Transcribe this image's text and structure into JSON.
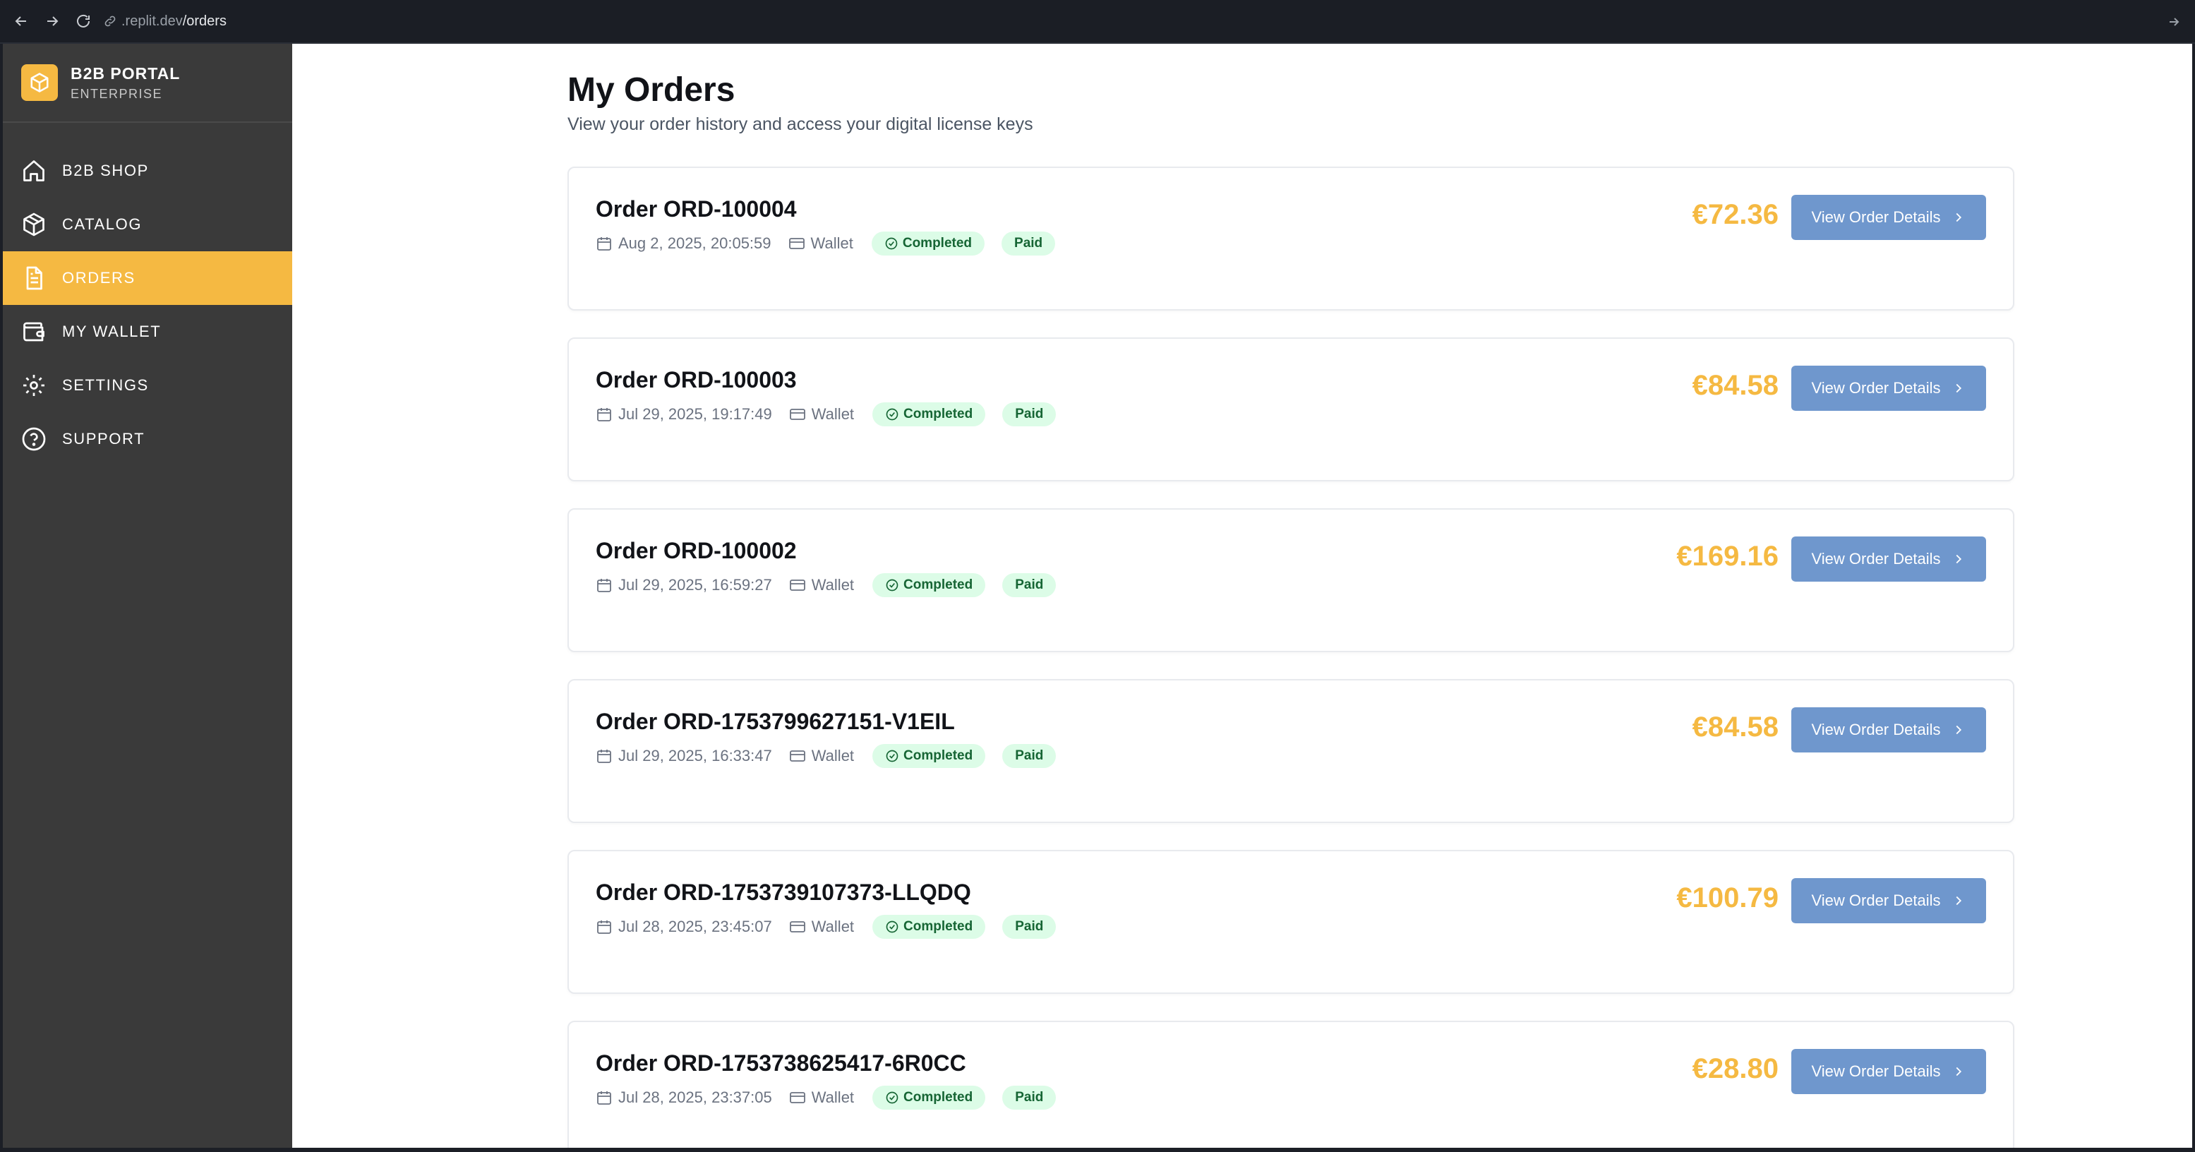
{
  "browser": {
    "url_domain": ".replit.dev",
    "url_path": "/orders"
  },
  "sidebar": {
    "brand_title": "B2B PORTAL",
    "brand_subtitle": "ENTERPRISE",
    "items": [
      {
        "label": "B2B SHOP",
        "icon": "home-icon",
        "active": false
      },
      {
        "label": "CATALOG",
        "icon": "box-icon",
        "active": false
      },
      {
        "label": "ORDERS",
        "icon": "document-icon",
        "active": true
      },
      {
        "label": "MY WALLET",
        "icon": "wallet-icon",
        "active": false
      },
      {
        "label": "SETTINGS",
        "icon": "gear-icon",
        "active": false
      },
      {
        "label": "SUPPORT",
        "icon": "help-icon",
        "active": false
      }
    ]
  },
  "main": {
    "title": "My Orders",
    "subtitle": "View your order history and access your digital license keys",
    "orders": [
      {
        "title": "Order ORD-100004",
        "date": "Aug 2, 2025, 20:05:59",
        "payment": "Wallet",
        "status": "Completed",
        "payment_status": "Paid",
        "price": "€72.36",
        "button": "View Order Details"
      },
      {
        "title": "Order ORD-100003",
        "date": "Jul 29, 2025, 19:17:49",
        "payment": "Wallet",
        "status": "Completed",
        "payment_status": "Paid",
        "price": "€84.58",
        "button": "View Order Details"
      },
      {
        "title": "Order ORD-100002",
        "date": "Jul 29, 2025, 16:59:27",
        "payment": "Wallet",
        "status": "Completed",
        "payment_status": "Paid",
        "price": "€169.16",
        "button": "View Order Details"
      },
      {
        "title": "Order ORD-1753799627151-V1EIL",
        "date": "Jul 29, 2025, 16:33:47",
        "payment": "Wallet",
        "status": "Completed",
        "payment_status": "Paid",
        "price": "€84.58",
        "button": "View Order Details"
      },
      {
        "title": "Order ORD-1753739107373-LLQDQ",
        "date": "Jul 28, 2025, 23:45:07",
        "payment": "Wallet",
        "status": "Completed",
        "payment_status": "Paid",
        "price": "€100.79",
        "button": "View Order Details"
      },
      {
        "title": "Order ORD-1753738625417-6R0CC",
        "date": "Jul 28, 2025, 23:37:05",
        "payment": "Wallet",
        "status": "Completed",
        "payment_status": "Paid",
        "price": "€28.80",
        "button": "View Order Details"
      }
    ]
  },
  "colors": {
    "accent": "#f5b942",
    "button": "#6f97cd",
    "sidebar": "#3a3a3a",
    "badge_bg": "#dcfce7",
    "badge_text": "#166534"
  }
}
